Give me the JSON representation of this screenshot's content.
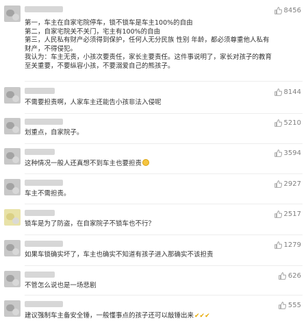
{
  "comments": [
    {
      "likes": "8456",
      "lines": [
        "第一，车主在自家宅院停车，锁不锁车是车主100%的自由",
        "第二，自家宅院关不关门，宅主有100%的自由",
        "第三，人民私有财产必须得到保护，任何人无分民族 性别 年龄，都必须尊重他人私有",
        "财产，不得侵犯。",
        "我认为：车主无责，小孩次要责任，家长主要责任。这件事说明了，家长对孩子的教育",
        "至关重要，不要纵容小孩，不要溺爱自己的熊孩子。"
      ]
    },
    {
      "likes": "8144",
      "lines": [
        "不需要担责啊，人家车主还能告小孩非法入侵呢"
      ]
    },
    {
      "likes": "5210",
      "lines": [
        "划重点，自家院子。"
      ]
    },
    {
      "likes": "3594",
      "lines": [
        "这种情况一般人还真想不到车主也要担责"
      ]
    },
    {
      "likes": "2927",
      "lines": [
        "车主不需担责。"
      ]
    },
    {
      "likes": "2517",
      "lines": [
        "锁车是为了防盗，在自家院子不锁车也不行？"
      ]
    },
    {
      "likes": "1279",
      "lines": [
        "如果车锁确实坏了，车主也确实不知道有孩子进入那确实不该担责"
      ]
    },
    {
      "likes": "626",
      "lines": [
        "不管怎么说也是一场悲剧"
      ]
    },
    {
      "likes": "555",
      "lines": [
        "建议强制车主备安全锤，一般懂事点的孩子还可以敲锤出来"
      ]
    }
  ],
  "icons": {
    "like": "thumbs-up-icon"
  },
  "colors": {
    "text": "#333333",
    "likes": "#808080"
  }
}
